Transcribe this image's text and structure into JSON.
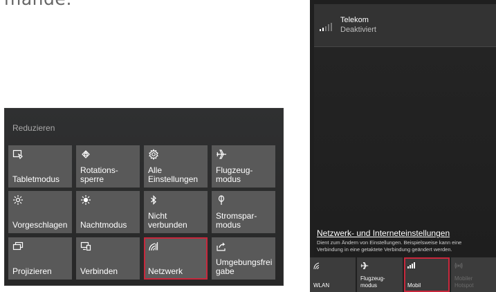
{
  "top_text": "mande:",
  "action_center": {
    "collapse_label": "Reduzieren",
    "tiles": [
      {
        "label": "Tabletmodus",
        "icon": "tablet-mode-icon"
      },
      {
        "label": "Rotations-\nsperre",
        "icon": "rotation-lock-icon"
      },
      {
        "label": "Alle\nEinstellungen",
        "icon": "gear-icon"
      },
      {
        "label": "Flugzeug-\nmodus",
        "icon": "airplane-icon"
      },
      {
        "label": "Vorgeschlagen",
        "icon": "brightness-icon"
      },
      {
        "label": "Nachtmodus",
        "icon": "night-light-icon"
      },
      {
        "label": "Nicht\nverbunden",
        "icon": "bluetooth-icon"
      },
      {
        "label": "Stromspar-\nmodus",
        "icon": "battery-saver-icon"
      },
      {
        "label": "Projizieren",
        "icon": "project-icon"
      },
      {
        "label": "Verbinden",
        "icon": "connect-icon"
      },
      {
        "label": "Netzwerk",
        "icon": "network-icon",
        "selected": true
      },
      {
        "label": "Umgebungsfrei\ngabe",
        "icon": "nearby-sharing-icon"
      }
    ]
  },
  "network_flyout": {
    "network": {
      "name": "Telekom",
      "status": "Deaktiviert"
    },
    "settings_link": "Netzwerk- und Interneteinstellungen",
    "settings_desc": "Dient zum Ändern von Einstellungen. Beispielsweise kann eine\nVerbindung in eine getaktete Verbindung geändert werden.",
    "quick_tiles": [
      {
        "label": "WLAN",
        "icon": "wifi-icon"
      },
      {
        "label": "Flugzeug-\nmodus",
        "icon": "airplane-icon"
      },
      {
        "label": "Mobil",
        "icon": "cellular-icon",
        "selected": true
      },
      {
        "label": "Mobiler\nHotspot",
        "icon": "hotspot-icon",
        "disabled": true
      }
    ]
  },
  "colors": {
    "highlight": "#c8283c",
    "tile": "#595959",
    "panel": "#2b2b2b"
  }
}
